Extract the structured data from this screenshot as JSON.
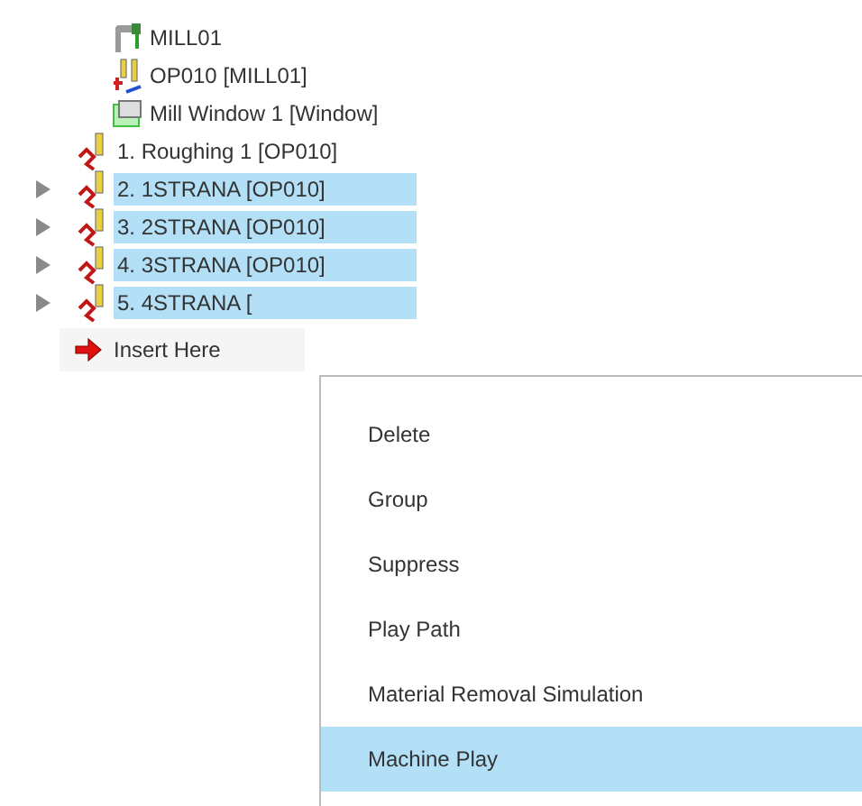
{
  "tree": {
    "items": [
      {
        "kind": "machine",
        "label": "MILL01",
        "selected": false
      },
      {
        "kind": "operation",
        "label": "OP010 [MILL01]",
        "selected": false
      },
      {
        "kind": "window",
        "label": "Mill Window 1 [Window]",
        "selected": false
      },
      {
        "kind": "toolpath",
        "label": "1. Roughing 1 [OP010]",
        "selected": false,
        "expandable": false
      },
      {
        "kind": "toolpath",
        "label": "2. 1STRANA [OP010]",
        "selected": true,
        "expandable": true
      },
      {
        "kind": "toolpath",
        "label": "3. 2STRANA [OP010]",
        "selected": true,
        "expandable": true
      },
      {
        "kind": "toolpath",
        "label": "4. 3STRANA [OP010]",
        "selected": true,
        "expandable": true
      },
      {
        "kind": "toolpath",
        "label": "5. 4STRANA [",
        "selected": true,
        "expandable": true
      }
    ],
    "insert": {
      "label": "Insert Here"
    }
  },
  "context_menu": {
    "items": [
      {
        "label": "Delete",
        "selected": false
      },
      {
        "label": "Group",
        "selected": false
      },
      {
        "label": "Suppress",
        "selected": false
      },
      {
        "label": "Play Path",
        "selected": false
      },
      {
        "label": "Material Removal Simulation",
        "selected": false
      },
      {
        "label": "Machine Play",
        "selected": true
      }
    ]
  }
}
